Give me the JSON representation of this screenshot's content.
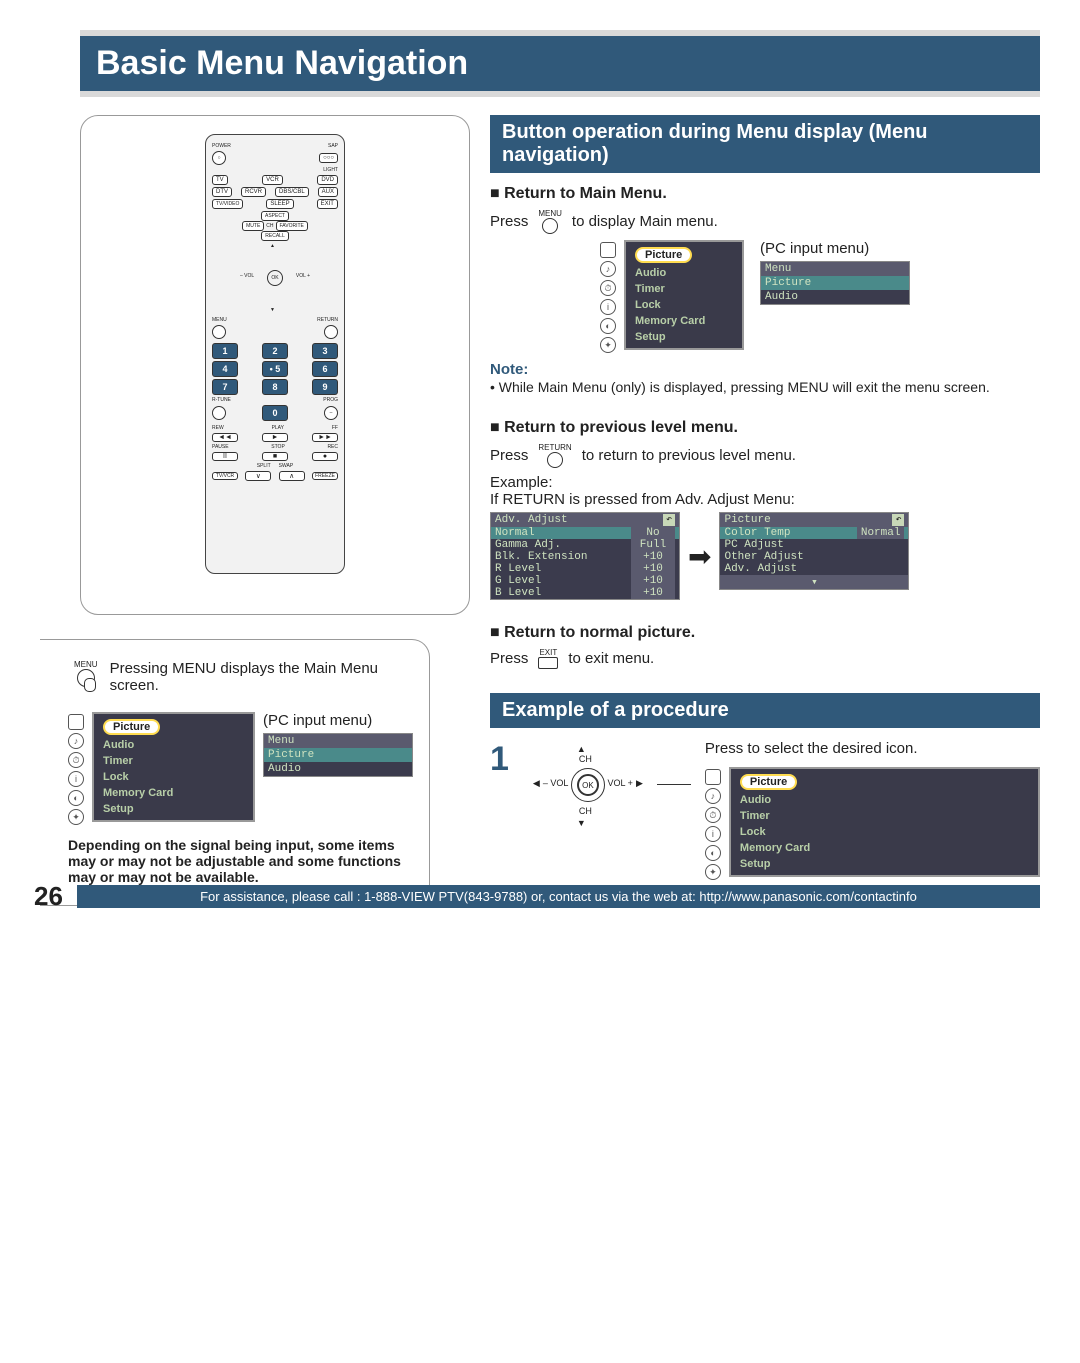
{
  "page": {
    "title": "Basic Menu Navigation",
    "number": "26"
  },
  "footer": "For assistance, please call : 1-888-VIEW PTV(843-9788) or, contact us via the web at: http://www.panasonic.com/contactinfo",
  "remote": {
    "power": "POWER",
    "sap": "SAP",
    "light": "LIGHT",
    "row1": [
      "TV",
      "VCR",
      "DVD"
    ],
    "row2": [
      "DTV",
      "RCVR",
      "DBS/CBL",
      "AUX"
    ],
    "row3": [
      "TV/VIDEO",
      "SLEEP",
      "EXIT"
    ],
    "diamond": [
      "MUTE",
      "ASPECT",
      "FAVORITE",
      "RECALL"
    ],
    "ch": "CH",
    "nav": {
      "ok": "OK",
      "left": "– VOL",
      "right": "VOL +",
      "up": "CH",
      "down": "CH"
    },
    "menu": "MENU",
    "return": "RETURN",
    "nums": [
      "1",
      "2",
      "3",
      "4",
      "• 5",
      "6",
      "7",
      "8",
      "9",
      "0"
    ],
    "rtune": "R-TUNE",
    "prog": "PROG",
    "transport_top": [
      "REW",
      "PLAY",
      "FF"
    ],
    "transport": [
      "◄◄",
      "►",
      "►►",
      "II",
      "■",
      "●"
    ],
    "transport_bot": [
      "PAUSE",
      "STOP",
      "REC"
    ],
    "split": "SPLIT",
    "swap": "SWAP",
    "freeze": "FREEZE",
    "tvvcr": "TV/VCR",
    "pipmin": "∨",
    "pipplus": "∧"
  },
  "lowerLeft": {
    "menuIcon": "MENU",
    "desc": "Pressing MENU displays the Main Menu screen.",
    "menuItems": [
      "Picture",
      "Audio",
      "Timer",
      "Lock",
      "Memory Card",
      "Setup"
    ],
    "pcLabel": "(PC input menu)",
    "pcMenu": {
      "head": "Menu",
      "items": [
        "Picture",
        "Audio"
      ]
    },
    "note": "Depending on the signal being input, some items may or may not be adjustable and some functions may or may not be available."
  },
  "right": {
    "heading1": "Button operation during Menu display (Menu navigation)",
    "sec1": {
      "title": "Return to Main Menu.",
      "press": "Press",
      "btn": "MENU",
      "after": "to display Main menu.",
      "menuItems": [
        "Picture",
        "Audio",
        "Timer",
        "Lock",
        "Memory Card",
        "Setup"
      ],
      "pcLabel": "(PC input menu)",
      "pcMenu": {
        "head": "Menu",
        "items": [
          "Picture",
          "Audio"
        ]
      },
      "noteT": "Note:",
      "note": "• While Main Menu (only) is displayed, pressing MENU will exit the menu screen."
    },
    "sec2": {
      "title": "Return to previous level menu.",
      "press": "Press",
      "btn": "RETURN",
      "after": "to return to previous level menu.",
      "example": "Example:",
      "exText": "If RETURN is pressed from Adv. Adjust Menu:",
      "adv": {
        "head": "Adv. Adjust",
        "rows": [
          {
            "l": "Normal",
            "v": "No"
          },
          {
            "l": "Gamma Adj.",
            "v": "Full"
          },
          {
            "l": "Blk. Extension",
            "v": "+10"
          },
          {
            "l": "R Level",
            "v": "+10"
          },
          {
            "l": "G Level",
            "v": "+10"
          },
          {
            "l": "B Level",
            "v": "+10"
          }
        ]
      },
      "pic": {
        "head": "Picture",
        "rows": [
          {
            "l": "Color Temp",
            "v": "Normal"
          },
          {
            "l": "PC Adjust",
            "v": ""
          },
          {
            "l": "Other Adjust",
            "v": ""
          },
          {
            "l": "Adv. Adjust",
            "v": ""
          }
        ],
        "moreDown": "▾"
      }
    },
    "sec3": {
      "title": "Return to normal picture.",
      "press": "Press",
      "btn": "EXIT",
      "after": "to exit menu."
    },
    "heading2": "Example of a procedure",
    "proc": {
      "num": "1",
      "nav": {
        "ok": "OK",
        "left": "– VOL",
        "right": "VOL +",
        "up": "CH",
        "down": "CH"
      },
      "text": "Press to select the desired icon.",
      "menuItems": [
        "Picture",
        "Audio",
        "Timer",
        "Lock",
        "Memory Card",
        "Setup"
      ]
    }
  }
}
